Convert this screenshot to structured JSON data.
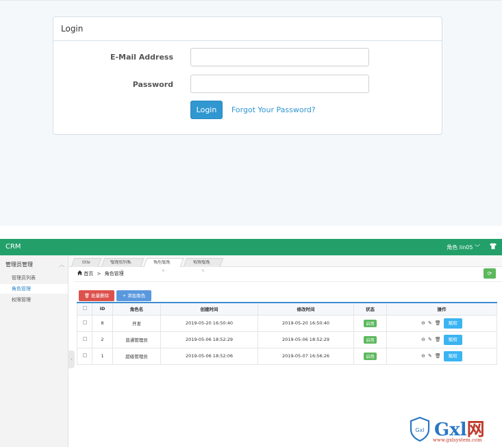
{
  "login": {
    "title": "Login",
    "email_label": "E-Mail Address",
    "email_value": "",
    "password_label": "Password",
    "password_value": "",
    "login_button": "Login",
    "forgot_link": "Forgot Your Password?"
  },
  "crm": {
    "brand": "CRM",
    "user_menu": "角色 lin05",
    "user_menu_caret": "﹀",
    "topbar_icon": "tshirt-icon",
    "sidebar": {
      "group": "管理员管理",
      "group_chevron": "︿",
      "items": [
        {
          "label": "管理员列表",
          "active": false
        },
        {
          "label": "角色管理",
          "active": true
        },
        {
          "label": "权限管理",
          "active": false
        }
      ]
    },
    "tabs": [
      {
        "label": "title",
        "closable": false,
        "active": false
      },
      {
        "label": "管理员列表",
        "closable": true,
        "active": false
      },
      {
        "label": "角色管理",
        "closable": true,
        "active": true
      },
      {
        "label": "权限管理",
        "closable": true,
        "active": false
      }
    ],
    "tab_close": "×",
    "breadcrumb": {
      "home": "首页",
      "separator": ">",
      "current": "角色管理"
    },
    "toolbar": {
      "batch_delete": "批量删除",
      "add_role": "添加角色"
    },
    "table": {
      "headers": [
        "",
        "ID",
        "角色名",
        "创建时间",
        "修改时间",
        "状态",
        "操作"
      ],
      "rows": [
        {
          "id": "8",
          "name": "开发",
          "created": "2019-05-20 16:50:40",
          "modified": "2019-05-20 16:50:40",
          "status": "启用",
          "action": "赋权"
        },
        {
          "id": "2",
          "name": "普通管理员",
          "created": "2019-05-06 18:52:29",
          "modified": "2019-05-06 18:52:29",
          "status": "启用",
          "action": "赋权"
        },
        {
          "id": "1",
          "name": "超级管理员",
          "created": "2019-05-06 18:52:06",
          "modified": "2019-05-07 16:56:26",
          "status": "启用",
          "action": "赋权"
        }
      ]
    },
    "watermark": {
      "logo_text": "Gxl",
      "logo_char": "网",
      "url": "www.gxlsystem.com"
    },
    "colors": {
      "topbar": "#23a06a",
      "accent_blue": "#3097d1",
      "danger": "#dd514c",
      "success": "#5eb95e"
    }
  }
}
